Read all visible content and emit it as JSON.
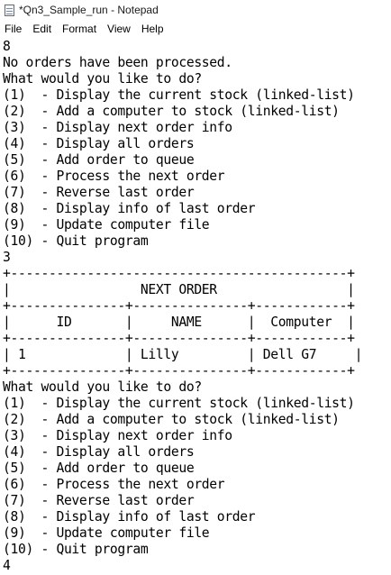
{
  "window": {
    "title": "*Qn3_Sample_run - Notepad"
  },
  "menu": [
    "File",
    "Edit",
    "Format",
    "View",
    "Help"
  ],
  "document": {
    "lines": [
      "8",
      "No orders have been processed.",
      "What would you like to do?",
      "(1)  - Display the current stock (linked-list)",
      "(2)  - Add a computer to stock (linked-list)",
      "(3)  - Display next order info",
      "(4)  - Display all orders",
      "(5)  - Add order to queue",
      "(6)  - Process the next order",
      "(7)  - Reverse last order",
      "(8)  - Display info of last order",
      "(9)  - Update computer file",
      "(10) - Quit program",
      "3",
      "+--------------------------------------------+",
      "|                 NEXT ORDER                 |",
      "+---------------+---------------+------------+",
      "|      ID       |     NAME      |  Computer  |",
      "+---------------+---------------+------------+",
      "| 1             | Lilly         | Dell G7     |",
      "+---------------+---------------+------------+",
      "What would you like to do?",
      "(1)  - Display the current stock (linked-list)",
      "(2)  - Add a computer to stock (linked-list)",
      "(3)  - Display next order info",
      "(4)  - Display all orders",
      "(5)  - Add order to queue",
      "(6)  - Process the next order",
      "(7)  - Reverse last order",
      "(8)  - Display info of last order",
      "(9)  - Update computer file",
      "(10) - Quit program",
      "4",
      ""
    ]
  }
}
